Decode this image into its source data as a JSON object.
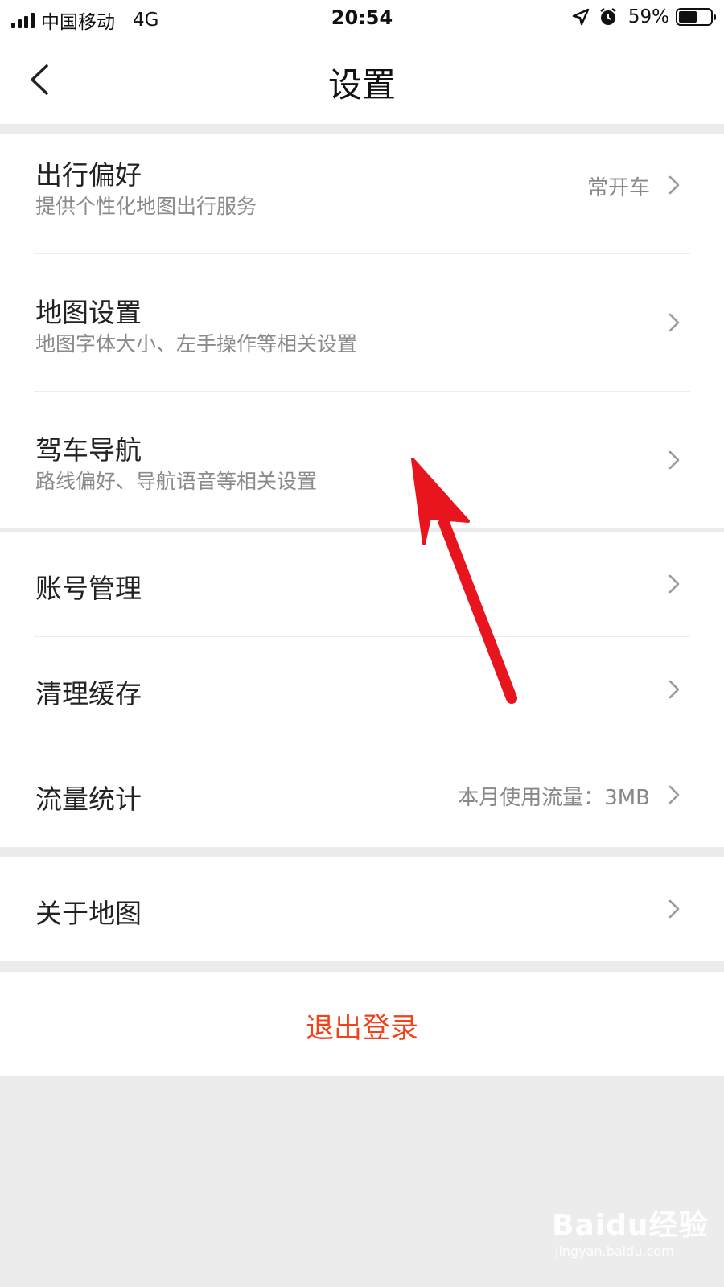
{
  "status_bar": {
    "carrier": "中国移动",
    "network": "4G",
    "time": "20:54",
    "battery": "59%",
    "battery_level": 0.59
  },
  "header": {
    "title": "设置",
    "back_icon": "chevron-left-icon"
  },
  "groups": [
    {
      "items": [
        {
          "title": "出行偏好",
          "subtitle": "提供个性化地图出行服务",
          "value": "常开车"
        },
        {
          "title": "地图设置",
          "subtitle": "地图字体大小、左手操作等相关设置"
        },
        {
          "title": "驾车导航",
          "subtitle": "路线偏好、导航语音等相关设置"
        }
      ]
    },
    {
      "items": [
        {
          "title": "账号管理"
        },
        {
          "title": "清理缓存"
        },
        {
          "title": "流量统计",
          "value": "本月使用流量：3MB"
        }
      ]
    },
    {
      "items": [
        {
          "title": "关于地图"
        }
      ]
    }
  ],
  "logout": {
    "label": "退出登录",
    "color": "#f0431b"
  },
  "annotation": {
    "arrow_color": "#e8141e"
  },
  "watermark": {
    "logo": "Baidu经验",
    "url": "jingyan.baidu.com"
  }
}
